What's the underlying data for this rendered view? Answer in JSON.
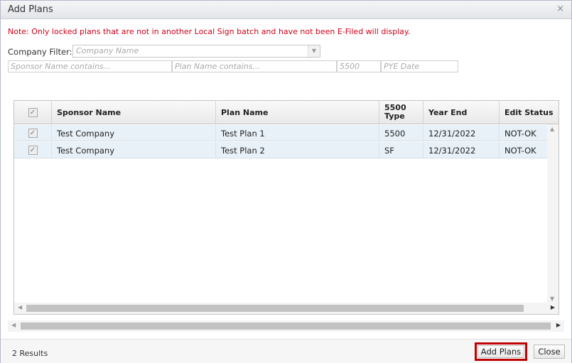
{
  "dialog": {
    "title": "Add Plans",
    "close_icon": "close-icon"
  },
  "note": "Note: Only locked plans that are not in another Local Sign batch and have not been E-Filed will display.",
  "filters": {
    "company_label": "Company Filter:",
    "company_placeholder": "Company Name",
    "sponsor_placeholder": "Sponsor Name contains...",
    "plan_placeholder": "Plan Name contains...",
    "type_placeholder": "5500",
    "pye_placeholder": "PYE Date"
  },
  "grid": {
    "columns": {
      "sponsor": "Sponsor Name",
      "plan": "Plan Name",
      "type_line1": "5500",
      "type_line2": "Type",
      "year_end": "Year End",
      "edit_status": "Edit Status"
    },
    "rows": [
      {
        "checked": true,
        "sponsor": "Test Company",
        "plan": "Test Plan 1",
        "type": "5500",
        "year_end": "12/31/2022",
        "edit_status": "NOT-OK"
      },
      {
        "checked": true,
        "sponsor": "Test Company",
        "plan": "Test Plan 2",
        "type": "SF",
        "year_end": "12/31/2022",
        "edit_status": "NOT-OK"
      }
    ]
  },
  "footer": {
    "results": "2 Results",
    "add_plans": "Add Plans",
    "close": "Close"
  },
  "colors": {
    "note": "#d0021b",
    "highlight_border": "#c00000",
    "row_bg": "#e8f1f7"
  }
}
